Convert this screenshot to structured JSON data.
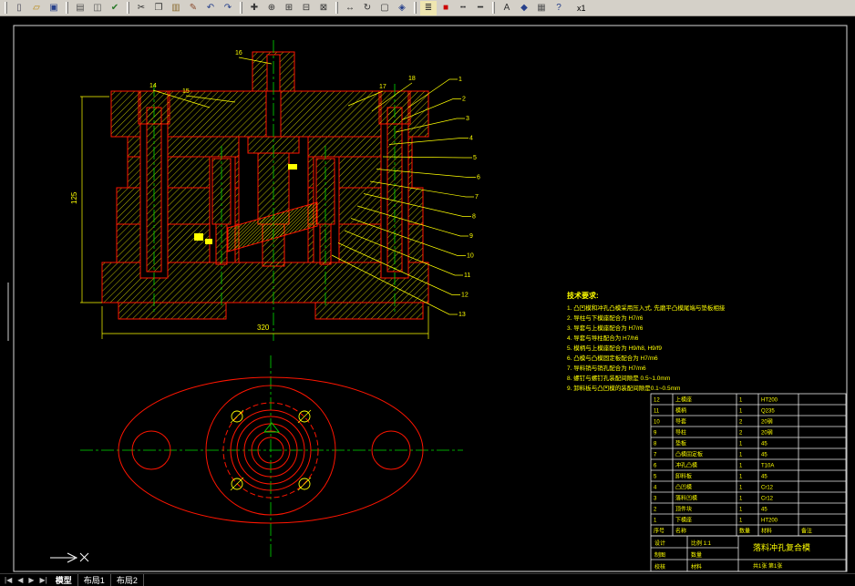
{
  "toolbar": {
    "zoom_label": "x1",
    "groups": [
      [
        {
          "n": "new-file",
          "g": "▯",
          "c": "#445"
        },
        {
          "n": "open-folder",
          "g": "▱",
          "c": "#b8860b"
        },
        {
          "n": "save",
          "g": "▣",
          "c": "#27408b"
        }
      ],
      [
        {
          "n": "plot",
          "g": "▤",
          "c": "#555"
        },
        {
          "n": "print-preview",
          "g": "◫",
          "c": "#555"
        },
        {
          "n": "spell-check",
          "g": "✔",
          "c": "#2a7a2a"
        }
      ],
      [
        {
          "n": "cut",
          "g": "✂",
          "c": "#333"
        },
        {
          "n": "copy",
          "g": "❐",
          "c": "#333"
        },
        {
          "n": "paste",
          "g": "▥",
          "c": "#8a6b2f"
        },
        {
          "n": "match-properties",
          "g": "✎",
          "c": "#8a4b2f"
        },
        {
          "n": "undo",
          "g": "↶",
          "c": "#27408b"
        },
        {
          "n": "redo",
          "g": "↷",
          "c": "#27408b"
        }
      ],
      [
        {
          "n": "pan",
          "g": "✚",
          "c": "#333"
        },
        {
          "n": "zoom-realtime",
          "g": "⊕",
          "c": "#333"
        },
        {
          "n": "zoom-window",
          "g": "⊞",
          "c": "#333"
        },
        {
          "n": "zoom-previous",
          "g": "⊟",
          "c": "#333"
        },
        {
          "n": "zoom-extents",
          "g": "⊠",
          "c": "#333"
        }
      ],
      [
        {
          "n": "distance",
          "g": "↔",
          "c": "#333"
        },
        {
          "n": "redraw",
          "g": "↻",
          "c": "#333"
        },
        {
          "n": "named-views",
          "g": "▢",
          "c": "#333"
        },
        {
          "n": "3d-orbit",
          "g": "◈",
          "c": "#27408b"
        }
      ],
      [
        {
          "n": "layers",
          "g": "≣",
          "c": "#333",
          "bg": "#efe6b0"
        },
        {
          "n": "color-control",
          "g": "■",
          "c": "#cc0000"
        },
        {
          "n": "linetype",
          "g": "╍",
          "c": "#333"
        },
        {
          "n": "lineweight",
          "g": "━",
          "c": "#333"
        }
      ],
      [
        {
          "n": "text",
          "g": "A",
          "c": "#333"
        },
        {
          "n": "block-insert",
          "g": "◆",
          "c": "#27408b"
        },
        {
          "n": "properties",
          "g": "▦",
          "c": "#555"
        },
        {
          "n": "help",
          "g": "?",
          "c": "#27408b"
        }
      ]
    ]
  },
  "tabs": {
    "nav": [
      "|◀",
      "◀",
      "▶",
      "▶|"
    ],
    "items": [
      "模型",
      "布局1",
      "布局2"
    ]
  },
  "drawing": {
    "dim_width": "320",
    "dim_height": "125",
    "callouts_top": [
      "14",
      "15",
      "16",
      "17",
      "18"
    ],
    "callouts_right": [
      "1",
      "2",
      "3",
      "4",
      "5",
      "6",
      "7",
      "8",
      "9",
      "10",
      "11",
      "12",
      "13"
    ],
    "tech_requirements": {
      "title": "技术要求:",
      "lines": [
        "1.  凸凹模和冲孔凸模采用压入式, 先磨平凸模尾端与垫板相接",
        "2.  导柱与下模座配合为 H7/r6",
        "3.  导套与上模座配合为 H7/r6",
        "4.  导套与导柱配合为 H7/h6",
        "5.  模柄与上模座配合为 H9/h8, H9/f9",
        "6.  凸模与凸模固定板配合为 H7/m6",
        "7.  导料销与销孔配合为 H7/m6",
        "8.  螺钉与螺钉孔装配间隙是 0.5~1.0mm",
        "9.  卸料板与凸凹模的装配间隙是0.1~0.5mm"
      ]
    },
    "parts_table": {
      "header": [
        "序号",
        "名称",
        "数量",
        "材料",
        "备注"
      ],
      "rows": [
        [
          "12",
          "上模座",
          "1",
          "HT200",
          ""
        ],
        [
          "11",
          "模柄",
          "1",
          "Q235",
          ""
        ],
        [
          "10",
          "导套",
          "2",
          "20钢",
          ""
        ],
        [
          "9",
          "导柱",
          "2",
          "20钢",
          ""
        ],
        [
          "8",
          "垫板",
          "1",
          "45",
          ""
        ],
        [
          "7",
          "凸模固定板",
          "1",
          "45",
          ""
        ],
        [
          "6",
          "冲孔凸模",
          "1",
          "T10A",
          ""
        ],
        [
          "5",
          "卸料板",
          "1",
          "45",
          ""
        ],
        [
          "4",
          "凸凹模",
          "1",
          "Cr12",
          ""
        ],
        [
          "3",
          "落料凹模",
          "1",
          "Cr12",
          ""
        ],
        [
          "2",
          "顶件块",
          "1",
          "45",
          ""
        ],
        [
          "1",
          "下模座",
          "1",
          "HT200",
          ""
        ]
      ]
    },
    "title_block": {
      "title": "落料冲孔复合模",
      "fields": [
        [
          "设计",
          ""
        ],
        [
          "制图",
          ""
        ],
        [
          "校核",
          ""
        ]
      ],
      "scale_label": "比例",
      "scale": "1:1",
      "qty_label": "数量",
      "material_label": "材料",
      "sheet": "共1张 第1张"
    }
  },
  "colors": {
    "outline": "#ff1500",
    "hatch": "#ffff00",
    "centerline": "#00dd00",
    "annotation": "#ffff00",
    "frame": "#d9d9d9",
    "table_grid": "#e8e8e8",
    "background": "#000000",
    "toolbar_bg": "#d4d0c8"
  }
}
